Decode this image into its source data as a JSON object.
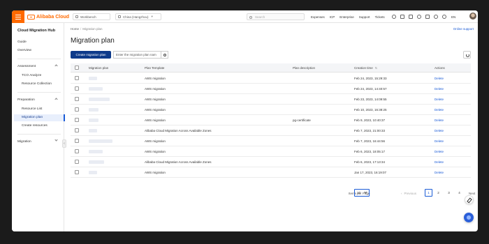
{
  "topbar": {
    "brand": "Alibaba Cloud",
    "workbench_label": "Workbench",
    "region_label": "China (Hangzhou)",
    "search_placeholder": "Search",
    "nav_links": [
      "Expenses",
      "ICP",
      "Enterprise",
      "Support",
      "Tickets"
    ],
    "icons": [
      "terminal-icon",
      "message-icon",
      "document-icon",
      "notification-icon",
      "cart-icon",
      "help-icon",
      "bulb-icon"
    ],
    "language": "EN"
  },
  "sidebar": {
    "title": "Cloud Migration Hub",
    "top_items": [
      "Guide",
      "Overview"
    ],
    "groups": [
      {
        "label": "Assessment",
        "items": [
          "TCO Analyze",
          "Resource Collection"
        ]
      },
      {
        "label": "Preparation",
        "items": [
          "Resource List",
          "Migration plan",
          "Create resources"
        ]
      },
      {
        "label": "Migration",
        "items": []
      }
    ],
    "active_item": "Migration plan"
  },
  "breadcrumb": {
    "home": "Home",
    "current": "Migration plan"
  },
  "online_support": "Online support",
  "page_title": "Migration plan",
  "create_button": "Create migration plan",
  "filter_placeholder": "Enter the migration plan nam",
  "table": {
    "headers": [
      "Migration plan",
      "Plan Template",
      "Plan description",
      "Creation time",
      "Actions"
    ],
    "rows": [
      {
        "template": "AWS migration",
        "description": "",
        "time": "Feb 24, 2023, 15:29:33",
        "action": "Delete"
      },
      {
        "template": "AWS migration",
        "description": "",
        "time": "Feb 24, 2023, 14:40:57",
        "action": "Delete"
      },
      {
        "template": "AWS migration",
        "description": "",
        "time": "Feb 23, 2023, 14:09:55",
        "action": "Delete"
      },
      {
        "template": "AWS migration",
        "description": "",
        "time": "Feb 10, 2023, 16:38:25",
        "action": "Delete"
      },
      {
        "template": "AWS migration",
        "description": "pg-certificate",
        "time": "Feb 9, 2023, 10:40:37",
        "action": "Delete"
      },
      {
        "template": "Alibaba Cloud Migration Across Available Zones",
        "description": "",
        "time": "Feb 7, 2023, 21:00:33",
        "action": "Delete"
      },
      {
        "template": "AWS migration",
        "description": "",
        "time": "Feb 7, 2023, 16:44:56",
        "action": "Delete"
      },
      {
        "template": "AWS migration",
        "description": "",
        "time": "Feb 6, 2023, 18:05:17",
        "action": "Delete"
      },
      {
        "template": "Alibaba Cloud Migration Across Available Zones",
        "description": "",
        "time": "Feb 6, 2023, 17:13:34",
        "action": "Delete"
      },
      {
        "template": "AWS migration",
        "description": "",
        "time": "Jan 17, 2023, 16:19:07",
        "action": "Delete"
      }
    ]
  },
  "pagination": {
    "items_per_page_label": "Items per Page",
    "per_page_value": "10",
    "previous": "Previous",
    "next": "Next",
    "pages": [
      "1",
      "2",
      "3",
      "4"
    ],
    "current": "1"
  }
}
